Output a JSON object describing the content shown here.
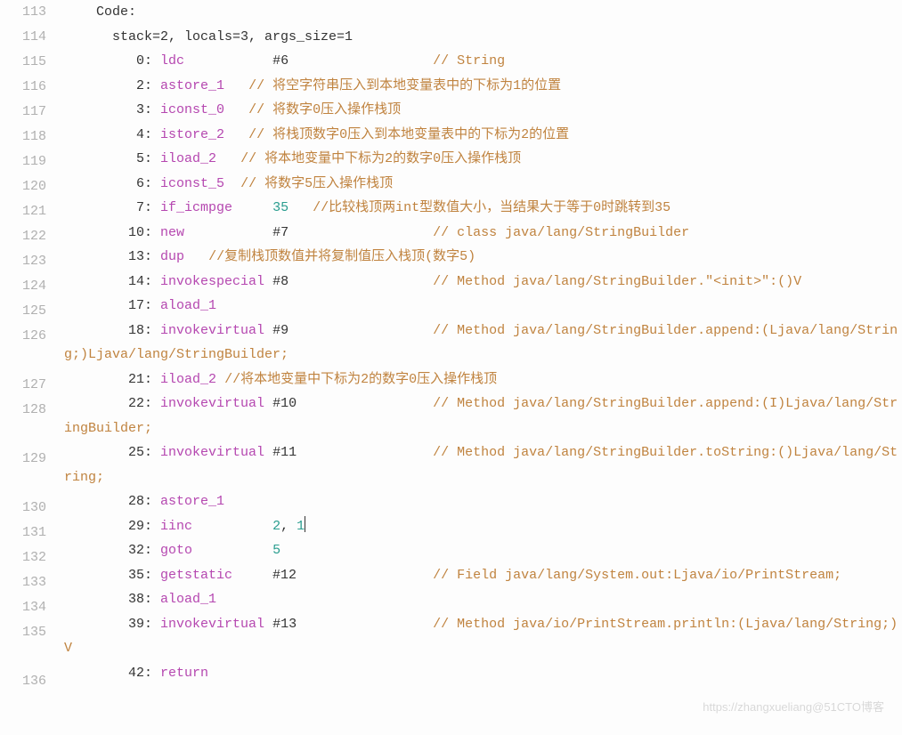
{
  "watermark": "https://zhangxueliang@51CTO博客",
  "lines": [
    {
      "n": 113,
      "seg": [
        [
          "    Code:",
          "p"
        ]
      ]
    },
    {
      "n": 114,
      "seg": [
        [
          "      stack=2, locals=3, args_size=1",
          "p"
        ]
      ]
    },
    {
      "n": 115,
      "seg": [
        [
          "         0: ",
          "p"
        ],
        [
          "ldc",
          "kw"
        ],
        [
          "           #6                  ",
          "p"
        ],
        [
          "// String",
          "cm"
        ]
      ]
    },
    {
      "n": 116,
      "seg": [
        [
          "         2: ",
          "p"
        ],
        [
          "astore_1",
          "kw"
        ],
        [
          "   ",
          "p"
        ],
        [
          "// 将空字符串压入到本地变量表中的下标为1的位置",
          "cm"
        ]
      ]
    },
    {
      "n": 117,
      "seg": [
        [
          "         3: ",
          "p"
        ],
        [
          "iconst_0",
          "kw"
        ],
        [
          "   ",
          "p"
        ],
        [
          "// 将数字0压入操作栈顶",
          "cm"
        ]
      ]
    },
    {
      "n": 118,
      "seg": [
        [
          "         4: ",
          "p"
        ],
        [
          "istore_2",
          "kw"
        ],
        [
          "   ",
          "p"
        ],
        [
          "// 将栈顶数字0压入到本地变量表中的下标为2的位置",
          "cm"
        ]
      ]
    },
    {
      "n": 119,
      "seg": [
        [
          "         5: ",
          "p"
        ],
        [
          "iload_2",
          "kw"
        ],
        [
          "   ",
          "p"
        ],
        [
          "// 将本地变量中下标为2的数字0压入操作栈顶",
          "cm"
        ]
      ]
    },
    {
      "n": 120,
      "seg": [
        [
          "         6: ",
          "p"
        ],
        [
          "iconst_5",
          "kw"
        ],
        [
          "  ",
          "p"
        ],
        [
          "// 将数字5压入操作栈顶",
          "cm"
        ]
      ]
    },
    {
      "n": 121,
      "seg": [
        [
          "         7: ",
          "p"
        ],
        [
          "if_icmpge",
          "kw"
        ],
        [
          "     ",
          "p"
        ],
        [
          "35",
          "num"
        ],
        [
          "   ",
          "p"
        ],
        [
          "//比较栈顶两int型数值大小，当结果大于等于0时跳转到35",
          "cm"
        ]
      ]
    },
    {
      "n": 122,
      "seg": [
        [
          "        10: ",
          "p"
        ],
        [
          "new",
          "kw"
        ],
        [
          "           #7                  ",
          "p"
        ],
        [
          "// class java/lang/StringBuilder",
          "cm"
        ]
      ]
    },
    {
      "n": 123,
      "seg": [
        [
          "        13: ",
          "p"
        ],
        [
          "dup",
          "kw"
        ],
        [
          "   ",
          "p"
        ],
        [
          "//复制栈顶数值并将复制值压入栈顶(数字5)",
          "cm"
        ]
      ]
    },
    {
      "n": 124,
      "seg": [
        [
          "        14: ",
          "p"
        ],
        [
          "invokespecial",
          "kw"
        ],
        [
          " #8                  ",
          "p"
        ],
        [
          "// Method java/lang/StringBuilder.\"<init>\":()V",
          "cm"
        ]
      ]
    },
    {
      "n": 125,
      "seg": [
        [
          "        17: ",
          "p"
        ],
        [
          "aload_1",
          "kw"
        ]
      ]
    },
    {
      "n": 126,
      "seg": [
        [
          "        18: ",
          "p"
        ],
        [
          "invokevirtual",
          "kw"
        ],
        [
          " #9                  ",
          "p"
        ],
        [
          "// Method java/lang/StringBuilder.append:(Ljava/lang/String;)Ljava/lang/StringBuilder;",
          "cm"
        ]
      ]
    },
    {
      "n": 127,
      "seg": [
        [
          "        21: ",
          "p"
        ],
        [
          "iload_2",
          "kw"
        ],
        [
          " ",
          "p"
        ],
        [
          "//将本地变量中下标为2的数字0压入操作栈顶",
          "cm"
        ]
      ]
    },
    {
      "n": 128,
      "seg": [
        [
          "        22: ",
          "p"
        ],
        [
          "invokevirtual",
          "kw"
        ],
        [
          " #10                 ",
          "p"
        ],
        [
          "// Method java/lang/StringBuilder.append:(I)Ljava/lang/StringBuilder;",
          "cm"
        ]
      ]
    },
    {
      "n": 129,
      "seg": [
        [
          "        25: ",
          "p"
        ],
        [
          "invokevirtual",
          "kw"
        ],
        [
          " #11                 ",
          "p"
        ],
        [
          "// Method java/lang/StringBuilder.toString:()Ljava/lang/String;",
          "cm"
        ]
      ]
    },
    {
      "n": 130,
      "seg": [
        [
          "        28: ",
          "p"
        ],
        [
          "astore_1",
          "kw"
        ]
      ]
    },
    {
      "n": 131,
      "seg": [
        [
          "        29: ",
          "p"
        ],
        [
          "iinc",
          "kw"
        ],
        [
          "          ",
          "p"
        ],
        [
          "2",
          "num"
        ],
        [
          ", ",
          "p"
        ],
        [
          "1",
          "num"
        ]
      ],
      "cursor": true
    },
    {
      "n": 132,
      "seg": [
        [
          "        32: ",
          "p"
        ],
        [
          "goto",
          "kw"
        ],
        [
          "          ",
          "p"
        ],
        [
          "5",
          "num"
        ]
      ]
    },
    {
      "n": 133,
      "seg": [
        [
          "        35: ",
          "p"
        ],
        [
          "getstatic",
          "kw"
        ],
        [
          "     #12                 ",
          "p"
        ],
        [
          "// Field java/lang/System.out:Ljava/io/PrintStream;",
          "cm"
        ]
      ]
    },
    {
      "n": 134,
      "seg": [
        [
          "        38: ",
          "p"
        ],
        [
          "aload_1",
          "kw"
        ]
      ]
    },
    {
      "n": 135,
      "seg": [
        [
          "        39: ",
          "p"
        ],
        [
          "invokevirtual",
          "kw"
        ],
        [
          " #13                 ",
          "p"
        ],
        [
          "// Method java/io/PrintStream.println:(Ljava/lang/String;)V",
          "cm"
        ]
      ]
    },
    {
      "n": 136,
      "seg": [
        [
          "        42: ",
          "p"
        ],
        [
          "return",
          "kw"
        ]
      ]
    }
  ]
}
